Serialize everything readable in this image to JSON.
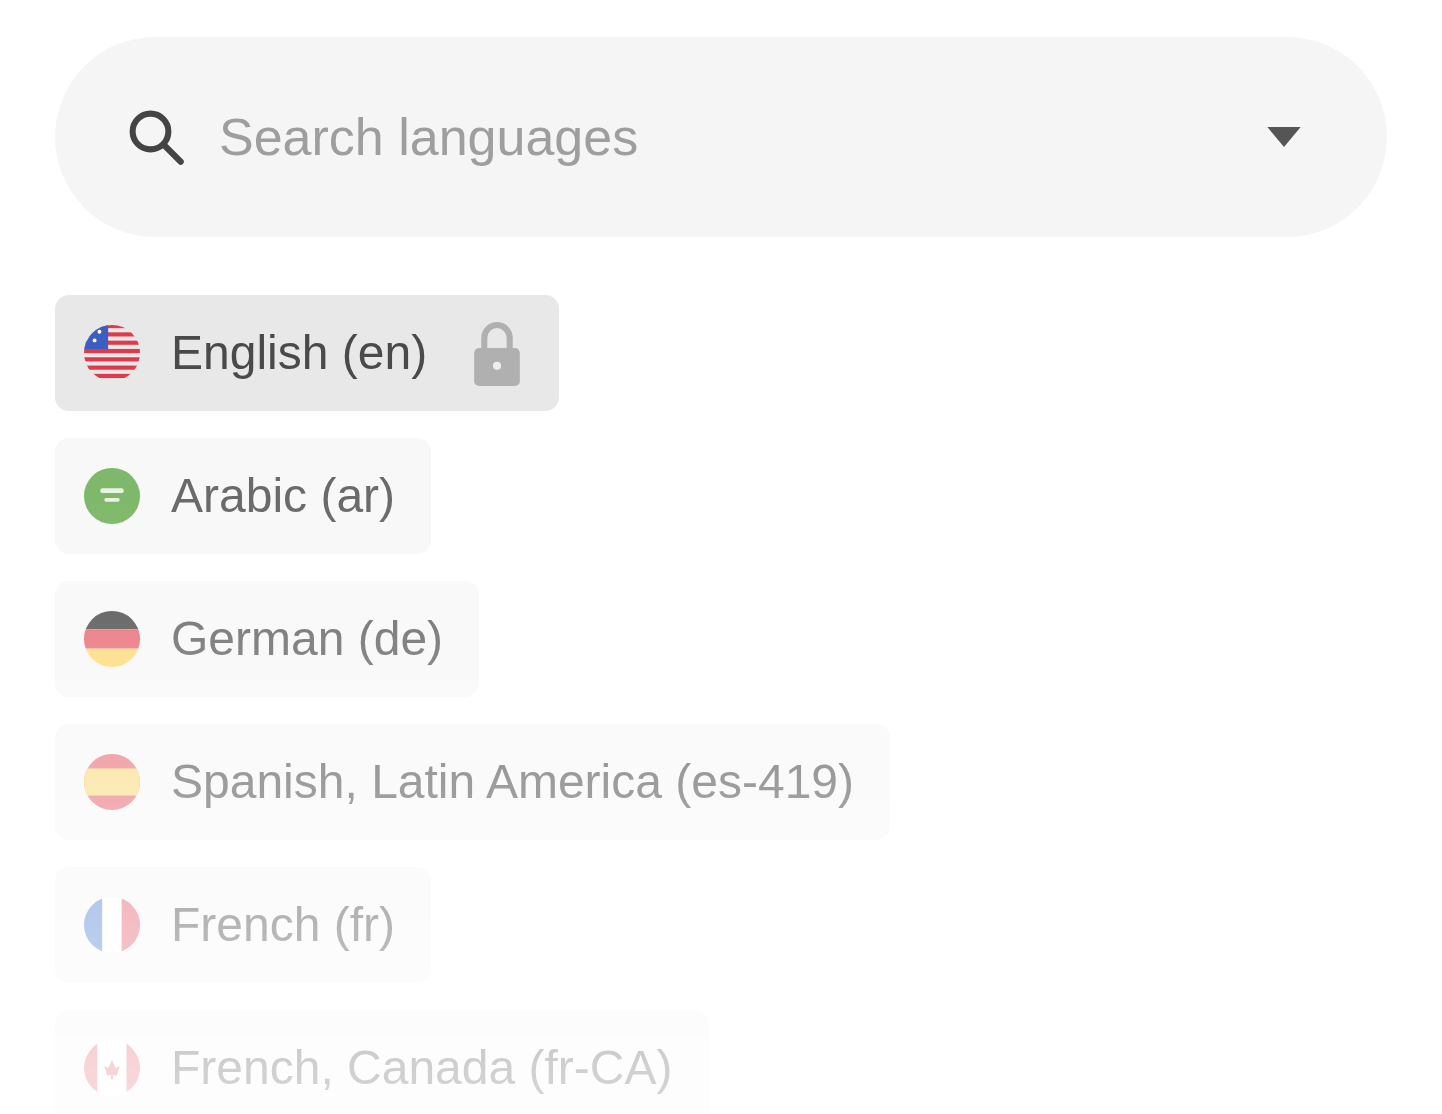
{
  "search": {
    "placeholder": "Search languages"
  },
  "languages": [
    {
      "label": "English (en)",
      "kind": "us",
      "selected": true,
      "locked": true
    },
    {
      "label": "Arabic (ar)",
      "kind": "sa",
      "selected": false,
      "locked": false
    },
    {
      "label": "German (de)",
      "kind": "de",
      "selected": false,
      "locked": false
    },
    {
      "label": "Spanish, Latin America (es-419)",
      "kind": "es",
      "selected": false,
      "locked": false
    },
    {
      "label": "French (fr)",
      "kind": "fr",
      "selected": false,
      "locked": false
    },
    {
      "label": "French, Canada (fr-CA)",
      "kind": "ca",
      "selected": false,
      "locked": false
    }
  ]
}
